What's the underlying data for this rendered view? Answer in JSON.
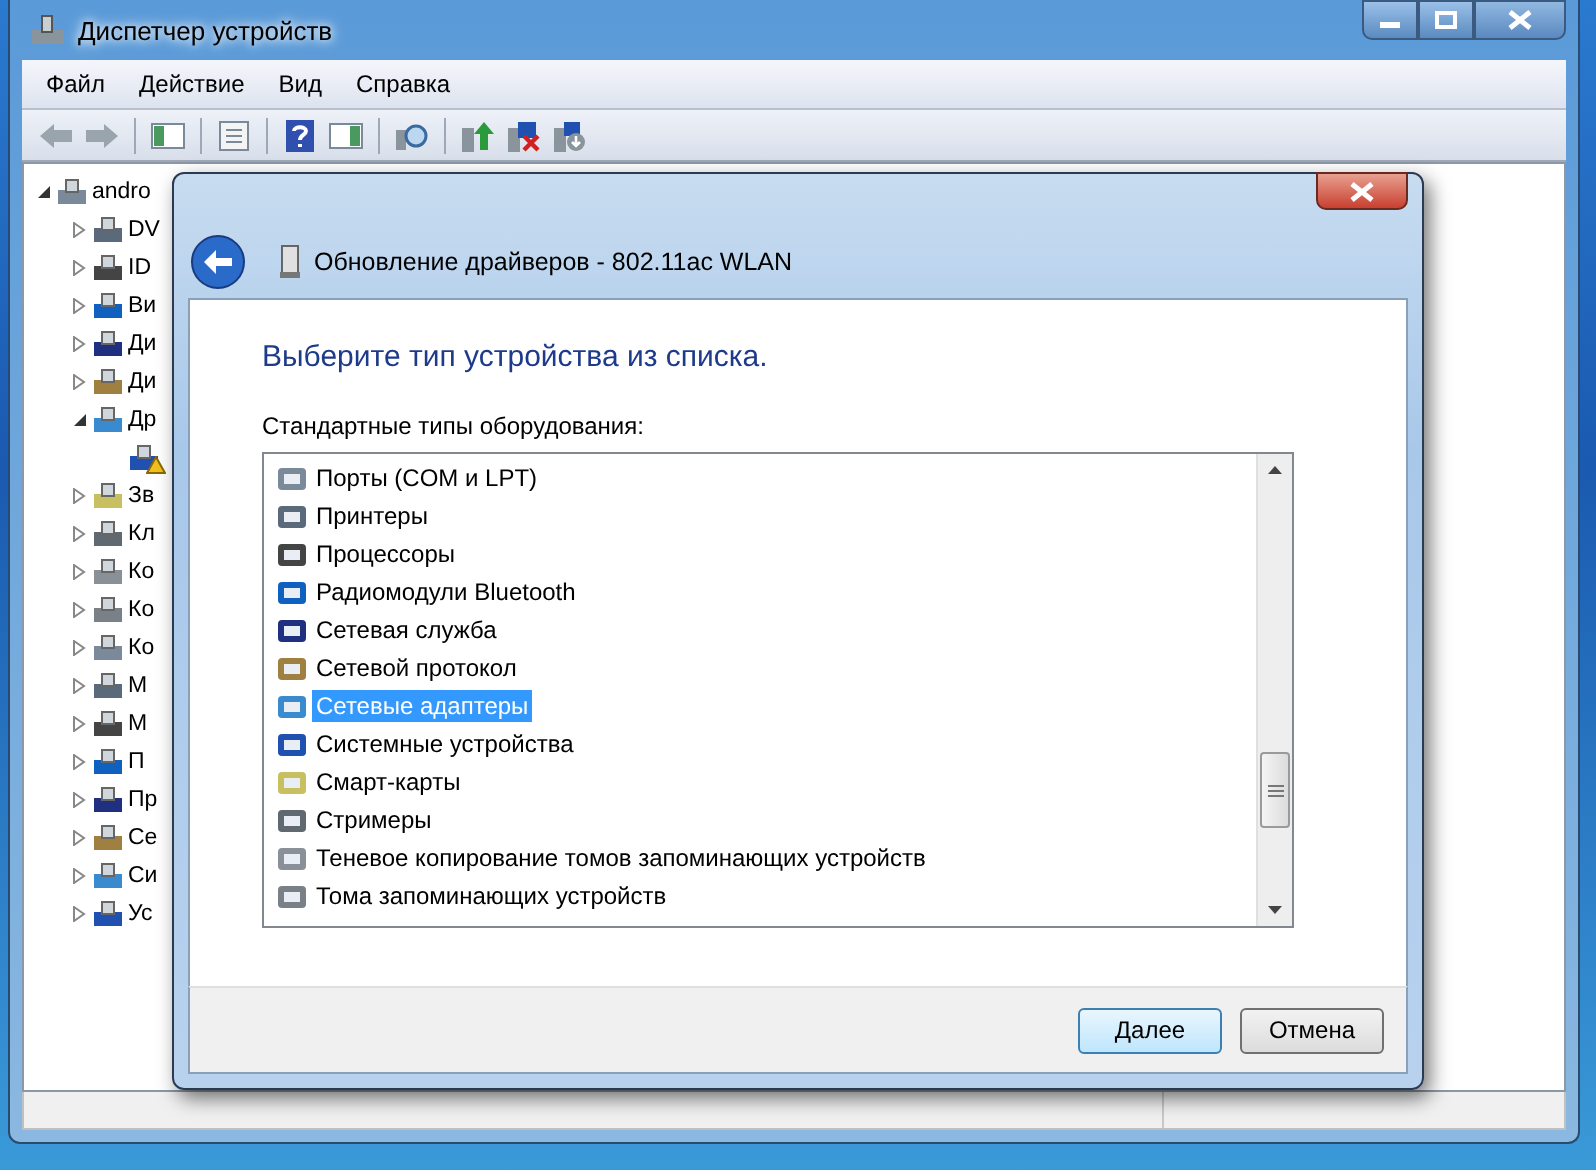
{
  "window": {
    "title": "Диспетчер устройств"
  },
  "menu": [
    "Файл",
    "Действие",
    "Вид",
    "Справка"
  ],
  "tree": {
    "label": "andro",
    "expanded": true,
    "children": [
      {
        "label": "DV",
        "expanded": false
      },
      {
        "label": "ID",
        "expanded": false
      },
      {
        "label": "Ви",
        "expanded": false
      },
      {
        "label": "Ди",
        "expanded": false
      },
      {
        "label": "Ди",
        "expanded": false
      },
      {
        "label": "Др",
        "expanded": true,
        "children": [
          {
            "warning": true
          }
        ]
      },
      {
        "label": "Зв",
        "expanded": false
      },
      {
        "label": "Кл",
        "expanded": false
      },
      {
        "label": "Ко",
        "expanded": false
      },
      {
        "label": "Ко",
        "expanded": false
      },
      {
        "label": "Ко",
        "expanded": false
      },
      {
        "label": "М",
        "expanded": false
      },
      {
        "label": "М",
        "expanded": false
      },
      {
        "label": "П",
        "expanded": false
      },
      {
        "label": "Пр",
        "expanded": false
      },
      {
        "label": "Се",
        "expanded": false
      },
      {
        "label": "Си",
        "expanded": false
      },
      {
        "label": "Ус",
        "expanded": false
      }
    ]
  },
  "dialog": {
    "title": "Обновление драйверов - 802.11ac WLAN",
    "heading": "Выберите тип устройства из списка.",
    "list_label": "Стандартные типы оборудования:",
    "items": [
      {
        "label": "Порты (COM и LPT)",
        "selected": false
      },
      {
        "label": "Принтеры",
        "selected": false
      },
      {
        "label": "Процессоры",
        "selected": false
      },
      {
        "label": "Радиомодули Bluetooth",
        "selected": false
      },
      {
        "label": "Сетевая служба",
        "selected": false
      },
      {
        "label": "Сетевой протокол",
        "selected": false
      },
      {
        "label": "Сетевые адаптеры",
        "selected": true
      },
      {
        "label": "Системные устройства",
        "selected": false
      },
      {
        "label": "Смарт-карты",
        "selected": false
      },
      {
        "label": "Стримеры",
        "selected": false
      },
      {
        "label": "Теневое копирование томов запоминающих устройств",
        "selected": false
      },
      {
        "label": "Тома запоминающих устройств",
        "selected": false
      }
    ],
    "buttons": [
      {
        "label": "Далее",
        "default": true
      },
      {
        "label": "Отмена",
        "default": false
      }
    ]
  }
}
